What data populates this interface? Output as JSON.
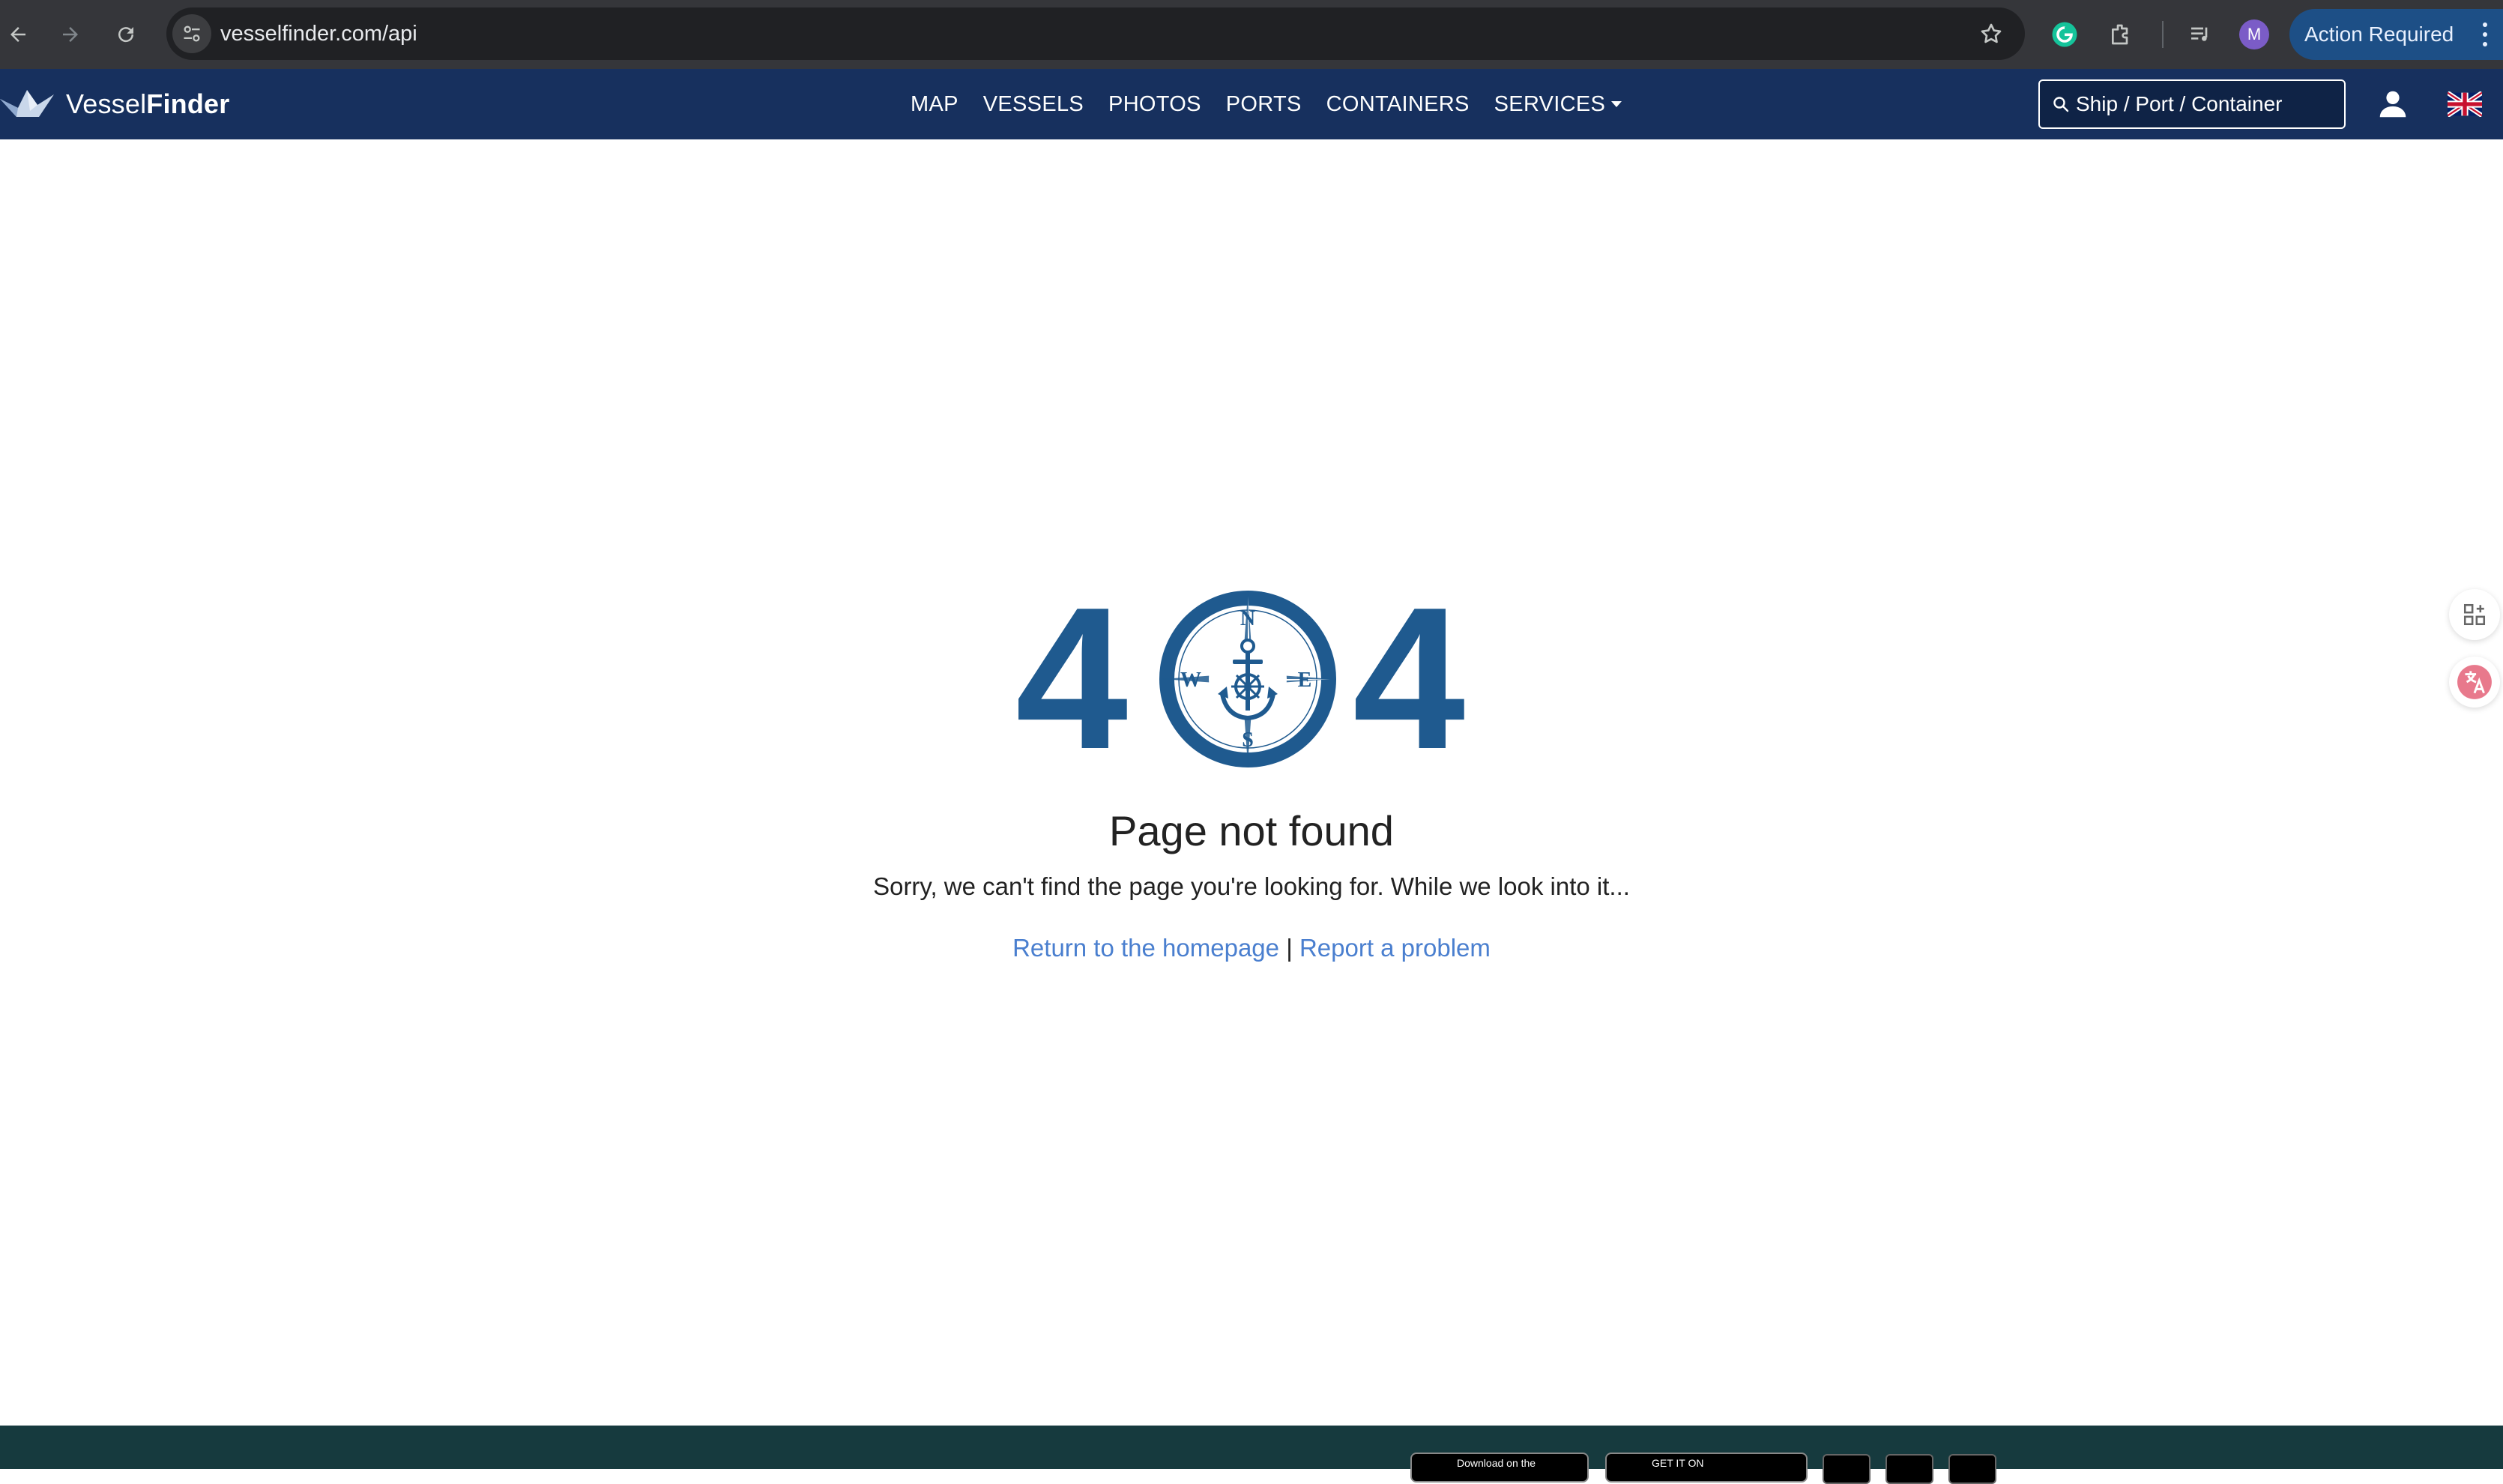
{
  "browser": {
    "url": "vesselfinder.com/api",
    "profile_initial": "M",
    "action_label": "Action Required"
  },
  "header": {
    "logo_prefix": "Vessel",
    "logo_suffix": "Finder",
    "nav": [
      "MAP",
      "VESSELS",
      "PHOTOS",
      "PORTS",
      "CONTAINERS",
      "SERVICES"
    ],
    "search_placeholder": "Ship / Port / Container"
  },
  "error": {
    "digit_left": "4",
    "digit_right": "4",
    "compass_n": "N",
    "compass_s": "S",
    "compass_e": "E",
    "compass_w": "W",
    "title": "Page not found",
    "description": "Sorry, we can't find the page you're looking for. While we look into it...",
    "link_home": "Return to the homepage",
    "separator": "|",
    "link_report": "Report a problem"
  },
  "footer": {
    "appstore_label": "Download on the",
    "googleplay_label": "GET IT ON"
  },
  "colors": {
    "header_bg": "#17305e",
    "accent_404": "#1f5a8f",
    "link": "#4a7fcf",
    "footer_bg": "#163a3e"
  }
}
